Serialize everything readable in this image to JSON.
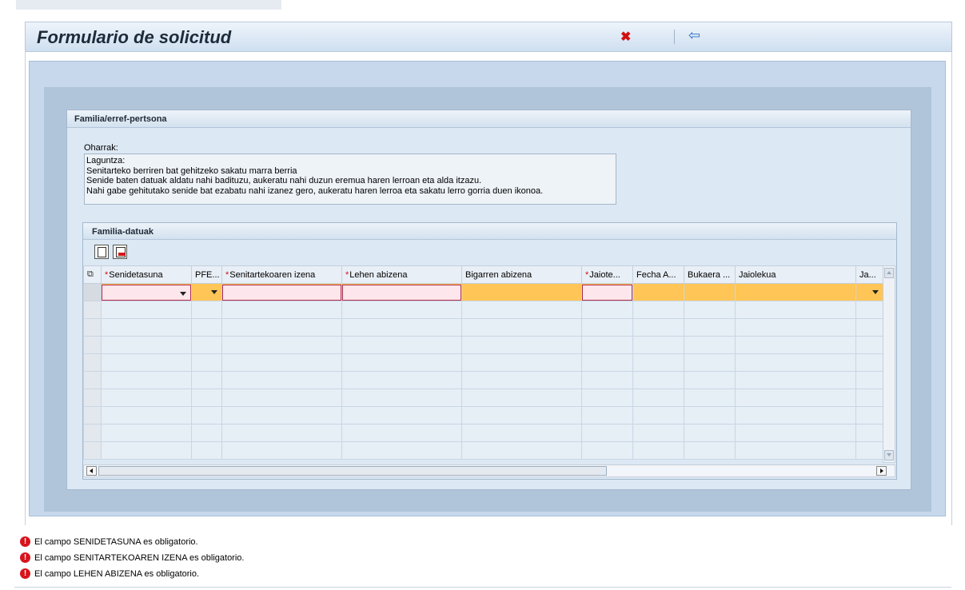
{
  "header": {
    "title": "Formulario de solicitud",
    "cancel_icon": "cancel-icon",
    "back_icon": "back-arrow-icon"
  },
  "panel": {
    "title": "Familia/erref-pertsona",
    "notes_label": "Oharrak:",
    "notes_lines": [
      "Laguntza:",
      "Senitarteko berriren bat gehitzeko sakatu marra berria",
      "Senide baten datuak aldatu nahi badituzu, aukeratu nahi duzun eremua haren lerroan eta alda itzazu.",
      "Nahi gabe gehitutako senide bat ezabatu nahi izanez gero, aukeratu haren lerroa eta sakatu lerro gorria duen ikonoa."
    ]
  },
  "table_panel": {
    "title": "Familia-datuak",
    "toolbar": [
      "new-row-icon",
      "delete-row-icon"
    ]
  },
  "table": {
    "columns": [
      {
        "label": "Senidetasuna",
        "required": true
      },
      {
        "label": "PFE...",
        "required": false
      },
      {
        "label": "Senitartekoaren izena",
        "required": true
      },
      {
        "label": "Lehen abizena",
        "required": true
      },
      {
        "label": "Bigarren abizena",
        "required": false
      },
      {
        "label": "Jaiote...",
        "required": true
      },
      {
        "label": "Fecha A...",
        "required": false
      },
      {
        "label": "Bukaera ...",
        "required": false
      },
      {
        "label": "Jaiolekua",
        "required": false
      },
      {
        "label": "Ja...",
        "required": false
      }
    ],
    "required_marker": "*"
  },
  "messages": [
    {
      "icon": "error-icon",
      "text": "El campo SENIDETASUNA es obligatorio."
    },
    {
      "icon": "error-icon",
      "text": "El campo SENITARTEKOAREN IZENA es obligatorio."
    },
    {
      "icon": "error-icon",
      "text": "El campo LEHEN ABIZENA es obligatorio."
    }
  ],
  "colors": {
    "selected_row": "#ffc657",
    "required_input_bg": "#fde7ec",
    "error": "#d9141b"
  }
}
